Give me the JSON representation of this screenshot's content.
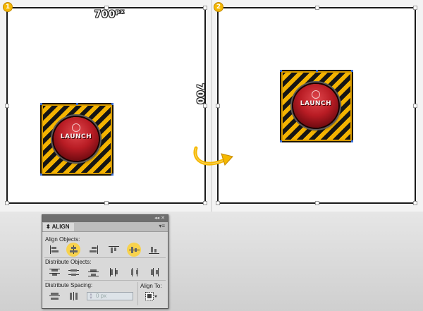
{
  "steps": [
    "1",
    "2"
  ],
  "dimensions": {
    "width_value": "700",
    "width_unit": "px",
    "height_value": "700"
  },
  "artwork": {
    "button_text": "LAUNCH"
  },
  "panel": {
    "title": "ALIGN",
    "titlebar_controls": "◂◂ ✕",
    "menu_icon": "▾≡",
    "align_objects_label": "Align Objects:",
    "distribute_objects_label": "Distribute Objects:",
    "distribute_spacing_label": "Distribute Spacing:",
    "spacing_value": "0 px",
    "align_to_label": "Align To:",
    "align_buttons": [
      {
        "icon": "horizontal-align-left-icon",
        "highlighted": false
      },
      {
        "icon": "horizontal-align-center-icon",
        "highlighted": true
      },
      {
        "icon": "horizontal-align-right-icon",
        "highlighted": false
      },
      {
        "icon": "vertical-align-top-icon",
        "highlighted": false
      },
      {
        "icon": "vertical-align-center-icon",
        "highlighted": true
      },
      {
        "icon": "vertical-align-bottom-icon",
        "highlighted": false
      }
    ],
    "distribute_buttons": [
      "vertical-distribute-top-icon",
      "vertical-distribute-center-icon",
      "vertical-distribute-bottom-icon",
      "horizontal-distribute-left-icon",
      "horizontal-distribute-center-icon",
      "horizontal-distribute-right-icon"
    ],
    "spacing_buttons": [
      "vertical-distribute-space-icon",
      "horizontal-distribute-space-icon"
    ],
    "align_to_icon": "align-to-artboard-icon"
  },
  "colors": {
    "accent": "#f5b800",
    "highlight": "#f7d24d",
    "button_red": "#b81c24"
  }
}
